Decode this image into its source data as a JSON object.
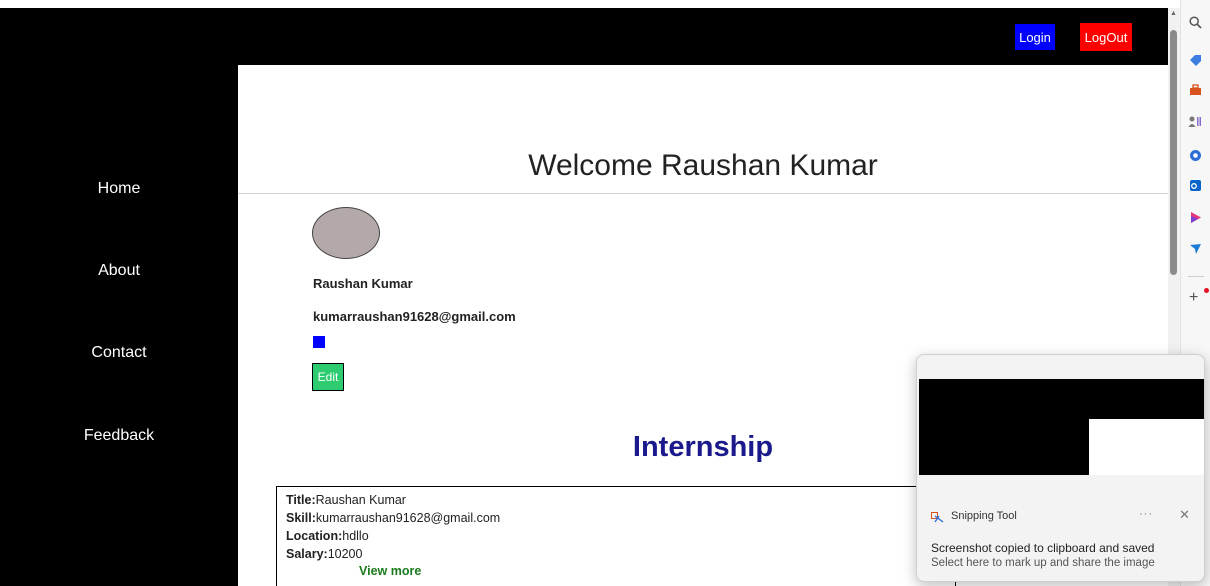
{
  "header": {
    "login_label": "Login",
    "logout_label": "LogOut"
  },
  "sidebar": {
    "items": [
      {
        "label": "Home"
      },
      {
        "label": "About"
      },
      {
        "label": "Contact"
      },
      {
        "label": "Feedback"
      }
    ]
  },
  "profile": {
    "welcome": "Welcome Raushan Kumar",
    "name": "Raushan Kumar",
    "email": "kumarraushan91628@gmail.com",
    "edit_label": "Edit"
  },
  "internship": {
    "heading": "Internship",
    "card": {
      "title_label": "Title:",
      "title_value": "Raushan Kumar",
      "skill_label": "Skill:",
      "skill_value": "kumarraushan91628@gmail.com",
      "location_label": "Location:",
      "location_value": "hdllo",
      "salary_label": "Salary:",
      "salary_value": "10200",
      "view_more_label": "View more"
    }
  },
  "browser_side_panel": {
    "icons": [
      "search-icon",
      "tag-icon",
      "toolbox-icon",
      "people-icon",
      "office-icon",
      "outlook-icon",
      "designer-icon",
      "send-icon"
    ],
    "add_icon": "plus-icon"
  },
  "toast": {
    "app_name": "Snipping Tool",
    "more_glyph": "···",
    "close_glyph": "✕",
    "title": "Screenshot copied to clipboard and saved",
    "subtitle": "Select here to mark up and share the image"
  },
  "colors": {
    "login_bg": "#0000ff",
    "logout_bg": "#ff0000",
    "edit_bg": "#2ecc71",
    "heading_color": "#1a1a8c",
    "view_more_color": "#1b7a1b"
  }
}
